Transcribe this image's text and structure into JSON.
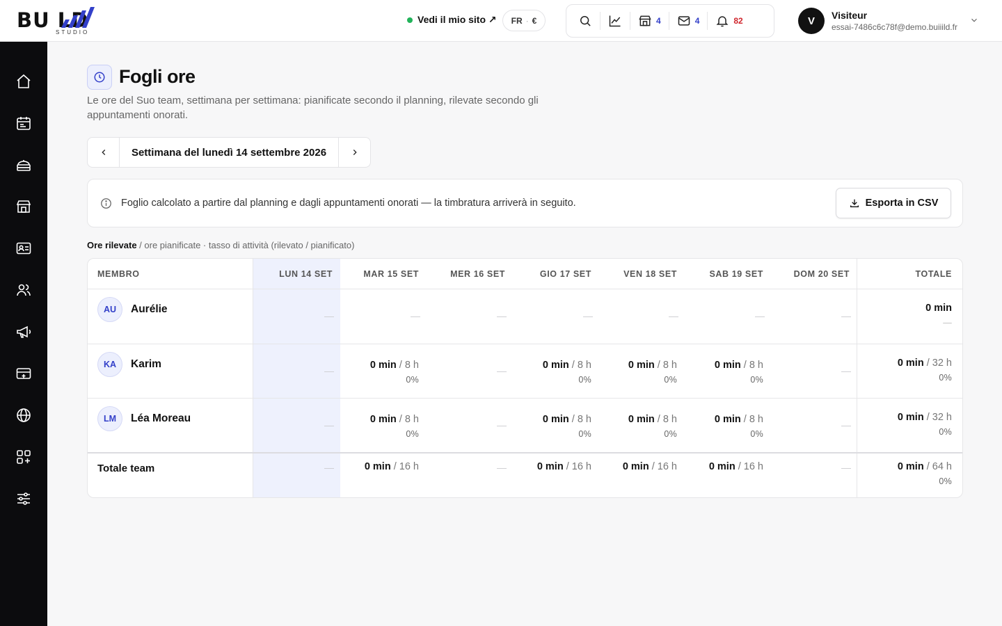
{
  "header": {
    "logo_text": "BU   LD",
    "logo_sub": "STUDIO",
    "site_link": "Vedi il mio sito ↗",
    "lang": "FR",
    "currency": "€",
    "counts": {
      "stores": "4",
      "messages": "4",
      "notifications": "82"
    },
    "user": {
      "initial": "V",
      "name": "Visiteur",
      "email": "essai-7486c6c78f@demo.buiiild.fr"
    }
  },
  "page": {
    "title": "Fogli ore",
    "description": "Le ore del Suo team, settimana per settimana: pianificate secondo il planning, rilevate secondo gli appuntamenti onorati.",
    "week_label": "Settimana del lunedì 14 settembre 2026",
    "info_text": "Foglio calcolato a partire dal planning e dagli appuntamenti onorati — la timbratura arriverà in seguito.",
    "export_label": "Esporta in CSV",
    "legend_bold": "Ore rilevate",
    "legend_rest": " / ore pianificate · tasso di attività (rilevato / pianificato)"
  },
  "table": {
    "headers": [
      "Membro",
      "Lun 14 set",
      "Mar 15 set",
      "Mer 16 set",
      "Gio 17 set",
      "Ven 18 set",
      "Sab 19 set",
      "Dom 20 set",
      "Totale"
    ],
    "rows": [
      {
        "initials": "AU",
        "name": "Aurélie",
        "days": [
          null,
          null,
          null,
          null,
          null,
          null,
          null
        ],
        "total": {
          "value": "0 min",
          "planned": "",
          "pct": "—"
        }
      },
      {
        "initials": "KA",
        "name": "Karim",
        "days": [
          null,
          {
            "value": "0 min",
            "planned": "/ 8 h",
            "pct": "0%"
          },
          null,
          {
            "value": "0 min",
            "planned": "/ 8 h",
            "pct": "0%"
          },
          {
            "value": "0 min",
            "planned": "/ 8 h",
            "pct": "0%"
          },
          {
            "value": "0 min",
            "planned": "/ 8 h",
            "pct": "0%"
          },
          null
        ],
        "total": {
          "value": "0 min",
          "planned": "/ 32 h",
          "pct": "0%"
        }
      },
      {
        "initials": "LM",
        "name": "Léa Moreau",
        "days": [
          null,
          {
            "value": "0 min",
            "planned": "/ 8 h",
            "pct": "0%"
          },
          null,
          {
            "value": "0 min",
            "planned": "/ 8 h",
            "pct": "0%"
          },
          {
            "value": "0 min",
            "planned": "/ 8 h",
            "pct": "0%"
          },
          {
            "value": "0 min",
            "planned": "/ 8 h",
            "pct": "0%"
          },
          null
        ],
        "total": {
          "value": "0 min",
          "planned": "/ 32 h",
          "pct": "0%"
        }
      }
    ],
    "team": {
      "label": "Totale team",
      "days": [
        null,
        {
          "value": "0 min",
          "planned": "/ 16 h"
        },
        null,
        {
          "value": "0 min",
          "planned": "/ 16 h"
        },
        {
          "value": "0 min",
          "planned": "/ 16 h"
        },
        {
          "value": "0 min",
          "planned": "/ 16 h"
        },
        null
      ],
      "total": {
        "value": "0 min",
        "planned": "/ 64 h",
        "pct": "0%"
      }
    }
  },
  "icons": [
    "home-icon",
    "calendar-icon",
    "services-icon",
    "store-icon",
    "contact-card-icon",
    "users-icon",
    "megaphone-icon",
    "payment-icon",
    "globe-icon",
    "apps-icon",
    "settings-sliders-icon"
  ]
}
